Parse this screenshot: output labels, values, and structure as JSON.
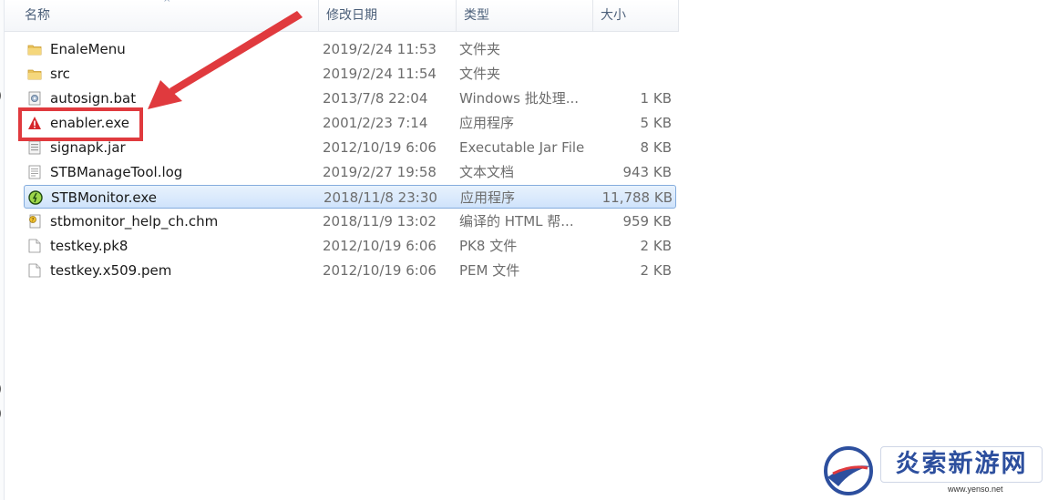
{
  "columns": {
    "name": "名称",
    "date": "修改日期",
    "type": "类型",
    "size": "大小"
  },
  "files": [
    {
      "name": "EnaleMenu",
      "date": "2019/2/24 11:53",
      "type": "文件夹",
      "size": "",
      "icon": "folder-icon",
      "selected": false
    },
    {
      "name": "src",
      "date": "2019/2/24 11:54",
      "type": "文件夹",
      "size": "",
      "icon": "folder-icon",
      "selected": false
    },
    {
      "name": "autosign.bat",
      "date": "2013/7/8 22:04",
      "type": "Windows 批处理...",
      "size": "1 KB",
      "icon": "batch-file-icon",
      "selected": false
    },
    {
      "name": "enabler.exe",
      "date": "2001/2/23 7:14",
      "type": "应用程序",
      "size": "5 KB",
      "icon": "warning-exe-icon",
      "selected": false
    },
    {
      "name": "signapk.jar",
      "date": "2012/10/19 6:06",
      "type": "Executable Jar File",
      "size": "8 KB",
      "icon": "jar-file-icon",
      "selected": false
    },
    {
      "name": "STBManageTool.log",
      "date": "2019/2/27 19:58",
      "type": "文本文档",
      "size": "943 KB",
      "icon": "text-file-icon",
      "selected": false
    },
    {
      "name": "STBMonitor.exe",
      "date": "2018/11/8 23:30",
      "type": "应用程序",
      "size": "11,788 KB",
      "icon": "monitor-exe-icon",
      "selected": true
    },
    {
      "name": "stbmonitor_help_ch.chm",
      "date": "2018/11/9 13:02",
      "type": "编译的 HTML 帮...",
      "size": "959 KB",
      "icon": "chm-help-icon",
      "selected": false
    },
    {
      "name": "testkey.pk8",
      "date": "2012/10/19 6:06",
      "type": "PK8 文件",
      "size": "2 KB",
      "icon": "blank-file-icon",
      "selected": false
    },
    {
      "name": "testkey.x509.pem",
      "date": "2012/10/19 6:06",
      "type": "PEM 文件",
      "size": "2 KB",
      "icon": "blank-file-icon",
      "selected": false
    }
  ],
  "watermark": {
    "title": "炎索新游网",
    "url": "www.yenso.net"
  },
  "colors": {
    "annotation": "#e03a3e",
    "selection_border": "#84acdd",
    "header_text": "#4c607a"
  }
}
